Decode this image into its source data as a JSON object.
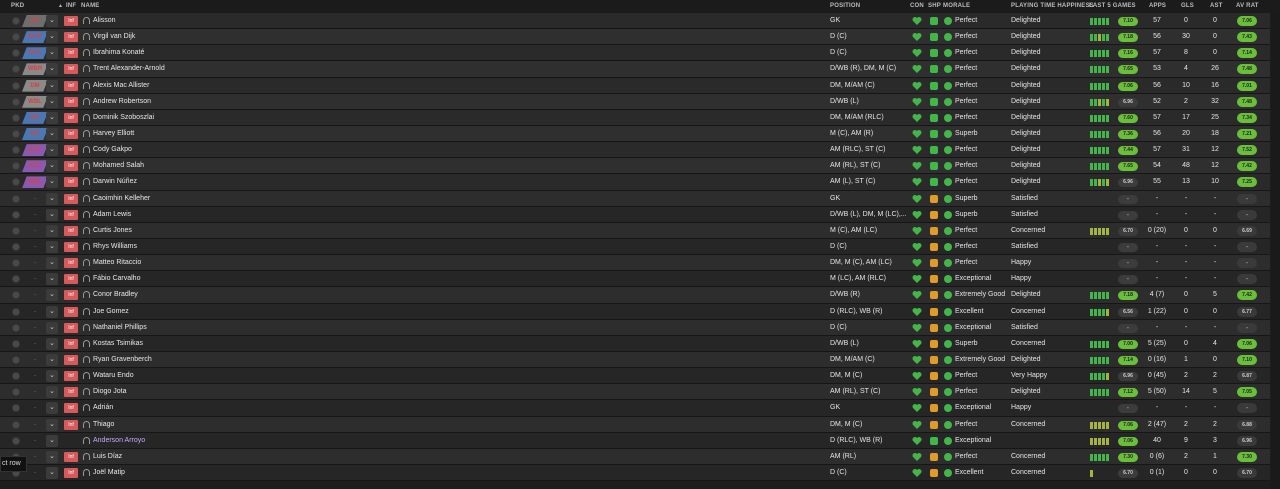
{
  "columns": {
    "pkd": "PKD",
    "inf": "INF",
    "name": "NAME",
    "position": "POSITION",
    "con": "CON",
    "shp": "SHP",
    "morale": "MORALE",
    "playing_time": "PLAYING TIME HAPPINESS",
    "last5": "LAST 5 GAMES",
    "apps": "APPS",
    "gls": "GLS",
    "ast": "AST",
    "avrat": "AV RAT"
  },
  "colors": {
    "badge_gk": "#6e6e6e",
    "badge_def": "#4a78b5",
    "badge_mid": "#8a8a8a",
    "badge_att": "#8b5ab0",
    "injury": "#d65a5a",
    "good": "#43b649",
    "warning": "#e09b2a",
    "rating": "#6abf3a"
  },
  "tooltip": "ct row",
  "players": [
    {
      "starter": true,
      "pos": "GK",
      "badge": "gk",
      "inj": "Inf",
      "name": "Alisson",
      "position": "GK",
      "shp": "green",
      "morale": "Perfect",
      "happy": "Delighted",
      "form": "ggggg",
      "last": "7.10",
      "apps": "57",
      "gls": "0",
      "ast": "0",
      "av": "7.06"
    },
    {
      "starter": true,
      "pos": "DCR",
      "badge": "def",
      "inj": "Inf",
      "name": "Virgil van Dijk",
      "position": "D (C)",
      "shp": "green",
      "morale": "Perfect",
      "happy": "Delighted",
      "form": "ggygg",
      "last": "7.18",
      "apps": "56",
      "gls": "30",
      "ast": "0",
      "av": "7.43"
    },
    {
      "starter": true,
      "pos": "DCL",
      "badge": "def",
      "inj": "Inf",
      "name": "Ibrahima Konaté",
      "position": "D (C)",
      "shp": "green",
      "morale": "Perfect",
      "happy": "Delighted",
      "form": "ggggg",
      "last": "7.16",
      "apps": "57",
      "gls": "8",
      "ast": "0",
      "av": "7.14"
    },
    {
      "starter": true,
      "pos": "WBR",
      "badge": "mid",
      "inj": "Inf",
      "name": "Trent Alexander-Arnold",
      "position": "D/WB (R), DM, M (C)",
      "shp": "green",
      "morale": "Perfect",
      "happy": "Delighted",
      "form": "ggggg",
      "last": "7.65",
      "apps": "53",
      "gls": "4",
      "ast": "26",
      "av": "7.48"
    },
    {
      "starter": true,
      "pos": "DM",
      "badge": "mid",
      "inj": "Inf",
      "name": "Alexis Mac Allister",
      "position": "DM, M/AM (C)",
      "shp": "green",
      "morale": "Perfect",
      "happy": "Delighted",
      "form": "ggggg",
      "last": "7.06",
      "apps": "56",
      "gls": "10",
      "ast": "16",
      "av": "7.01"
    },
    {
      "starter": true,
      "pos": "WBL",
      "badge": "mid",
      "inj": "Inf",
      "name": "Andrew Robertson",
      "position": "D/WB (L)",
      "shp": "green",
      "morale": "Perfect",
      "happy": "Delighted",
      "form": "ggygy",
      "last": "6.96",
      "apps": "52",
      "gls": "2",
      "ast": "32",
      "av": "7.48"
    },
    {
      "starter": true,
      "pos": "MC",
      "badge": "def",
      "inj": "Inf",
      "name": "Dominik Szoboszlai",
      "position": "DM, M/AM (RLC)",
      "shp": "green",
      "morale": "Perfect",
      "happy": "Delighted",
      "form": "ggggg",
      "last": "7.60",
      "apps": "57",
      "gls": "17",
      "ast": "25",
      "av": "7.34"
    },
    {
      "starter": true,
      "pos": "MC",
      "badge": "def",
      "inj": "Inf",
      "name": "Harvey Elliott",
      "position": "M (C), AM (R)",
      "shp": "green",
      "morale": "Superb",
      "happy": "Delighted",
      "form": "ggggg",
      "last": "7.36",
      "apps": "56",
      "gls": "20",
      "ast": "18",
      "av": "7.21"
    },
    {
      "starter": true,
      "pos": "STC",
      "badge": "att",
      "inj": "Inf",
      "name": "Cody Gakpo",
      "position": "AM (RLC), ST (C)",
      "shp": "green",
      "morale": "Perfect",
      "happy": "Delighted",
      "form": "ggggg",
      "last": "7.44",
      "apps": "57",
      "gls": "31",
      "ast": "12",
      "av": "7.52"
    },
    {
      "starter": true,
      "pos": "STC",
      "badge": "att",
      "inj": "Inf",
      "name": "Mohamed Salah",
      "position": "AM (RL), ST (C)",
      "shp": "green",
      "morale": "Perfect",
      "happy": "Delighted",
      "form": "ggggg",
      "last": "7.65",
      "apps": "54",
      "gls": "48",
      "ast": "12",
      "av": "7.42"
    },
    {
      "starter": true,
      "pos": "MDL",
      "badge": "att",
      "inj": "Inf",
      "name": "Darwin Núñez",
      "position": "AM (L), ST (C)",
      "shp": "green",
      "morale": "Perfect",
      "happy": "Delighted",
      "form": "ggygy",
      "last": "6.96",
      "apps": "55",
      "gls": "13",
      "ast": "10",
      "av": "7.25"
    },
    {
      "starter": false,
      "pos": "-",
      "badge": "",
      "inj": "Inf",
      "name": "Caoimhin Kelleher",
      "position": "GK",
      "shp": "orange",
      "morale": "Superb",
      "happy": "Satisfied",
      "form": "",
      "last": "-",
      "apps": "-",
      "gls": "-",
      "ast": "-",
      "av": "-"
    },
    {
      "starter": false,
      "pos": "-",
      "badge": "",
      "inj": "Inf",
      "name": "Adam Lewis",
      "position": "D/WB (L), DM, M (LC),...",
      "shp": "orange",
      "morale": "Superb",
      "happy": "Satisfied",
      "form": "",
      "last": "-",
      "apps": "-",
      "gls": "-",
      "ast": "-",
      "av": "-"
    },
    {
      "starter": false,
      "pos": "-",
      "badge": "",
      "inj": "Inf",
      "name": "Curtis Jones",
      "position": "M (C), AM (LC)",
      "shp": "orange",
      "morale": "Perfect",
      "happy": "Concerned",
      "form": "yyyyy",
      "last": "6.70",
      "apps": "0 (20)",
      "gls": "0",
      "ast": "0",
      "av": "6.69"
    },
    {
      "starter": false,
      "pos": "-",
      "badge": "",
      "inj": "Inf",
      "name": "Rhys Williams",
      "position": "D (C)",
      "shp": "orange",
      "morale": "Perfect",
      "happy": "Satisfied",
      "form": "",
      "last": "-",
      "apps": "-",
      "gls": "-",
      "ast": "-",
      "av": "-"
    },
    {
      "starter": false,
      "pos": "-",
      "badge": "",
      "inj": "Inf",
      "name": "Matteo Ritaccio",
      "position": "DM, M (C), AM (LC)",
      "shp": "orange",
      "morale": "Perfect",
      "happy": "Happy",
      "form": "",
      "last": "-",
      "apps": "-",
      "gls": "-",
      "ast": "-",
      "av": "-"
    },
    {
      "starter": false,
      "pos": "-",
      "badge": "",
      "inj": "Inf",
      "name": "Fábio Carvalho",
      "position": "M (LC), AM (RLC)",
      "shp": "orange",
      "morale": "Exceptional",
      "happy": "Happy",
      "form": "",
      "last": "-",
      "apps": "-",
      "gls": "-",
      "ast": "-",
      "av": "-"
    },
    {
      "starter": false,
      "pos": "-",
      "badge": "",
      "inj": "Inf",
      "name": "Conor Bradley",
      "position": "D/WB (R)",
      "shp": "orange",
      "morale": "Extremely Good",
      "happy": "Delighted",
      "form": "ggggg",
      "last": "7.18",
      "apps": "4 (7)",
      "gls": "0",
      "ast": "5",
      "av": "7.42"
    },
    {
      "starter": false,
      "pos": "-",
      "badge": "",
      "inj": "Inf",
      "name": "Joe Gomez",
      "position": "D (RLC), WB (R)",
      "shp": "orange",
      "morale": "Excellent",
      "happy": "Concerned",
      "form": "ggggy",
      "last": "6.56",
      "apps": "1 (22)",
      "gls": "0",
      "ast": "0",
      "av": "6.77"
    },
    {
      "starter": false,
      "pos": "-",
      "badge": "",
      "inj": "Inf",
      "name": "Nathaniel Phillips",
      "position": "D (C)",
      "shp": "orange",
      "morale": "Exceptional",
      "happy": "Satisfied",
      "form": "",
      "last": "-",
      "apps": "-",
      "gls": "-",
      "ast": "-",
      "av": "-"
    },
    {
      "starter": false,
      "pos": "-",
      "badge": "",
      "inj": "Inf",
      "name": "Kostas Tsimikas",
      "position": "D/WB (L)",
      "shp": "orange",
      "morale": "Superb",
      "happy": "Concerned",
      "form": "ggggg",
      "last": "7.00",
      "apps": "5 (25)",
      "gls": "0",
      "ast": "4",
      "av": "7.06"
    },
    {
      "starter": false,
      "pos": "-",
      "badge": "",
      "inj": "Inf",
      "name": "Ryan Gravenberch",
      "position": "DM, M/AM (C)",
      "shp": "orange",
      "morale": "Extremely Good",
      "happy": "Delighted",
      "form": "ggggg",
      "last": "7.14",
      "apps": "0 (16)",
      "gls": "1",
      "ast": "0",
      "av": "7.10"
    },
    {
      "starter": false,
      "pos": "-",
      "badge": "",
      "inj": "Inf",
      "name": "Wataru Endo",
      "position": "DM, M (C)",
      "shp": "orange",
      "morale": "Perfect",
      "happy": "Very Happy",
      "form": "ggggy",
      "last": "6.96",
      "apps": "0 (45)",
      "gls": "2",
      "ast": "2",
      "av": "6.87"
    },
    {
      "starter": false,
      "pos": "-",
      "badge": "",
      "inj": "Inf",
      "name": "Diogo Jota",
      "position": "AM (RL), ST (C)",
      "shp": "orange",
      "morale": "Perfect",
      "happy": "Delighted",
      "form": "ggggg",
      "last": "7.12",
      "apps": "5 (50)",
      "gls": "14",
      "ast": "5",
      "av": "7.05"
    },
    {
      "starter": false,
      "pos": "-",
      "badge": "",
      "inj": "Inf",
      "name": "Adrián",
      "position": "GK",
      "shp": "orange",
      "morale": "Exceptional",
      "happy": "Happy",
      "form": "",
      "last": "-",
      "apps": "-",
      "gls": "-",
      "ast": "-",
      "av": "-"
    },
    {
      "starter": false,
      "pos": "-",
      "badge": "",
      "inj": "Inf",
      "name": "Thiago",
      "position": "DM, M (C)",
      "shp": "orange",
      "morale": "Perfect",
      "happy": "Concerned",
      "form": "yyyyy",
      "last": "7.06",
      "apps": "2 (47)",
      "gls": "2",
      "ast": "2",
      "av": "6.88"
    },
    {
      "starter": false,
      "pos": "-",
      "badge": "",
      "inj": "",
      "name": "Anderson Arroyo",
      "position": "D (RLC), WB (R)",
      "shp": "green",
      "morale": "Exceptional",
      "happy": "",
      "form": "yyyyy",
      "last": "7.06",
      "apps": "40",
      "gls": "9",
      "ast": "3",
      "av": "6.96",
      "purple": true
    },
    {
      "starter": false,
      "pos": "-",
      "badge": "",
      "inj": "Inf",
      "name": "Luis Díaz",
      "position": "AM (RL)",
      "shp": "orange",
      "morale": "Perfect",
      "happy": "Concerned",
      "form": "ggggg",
      "last": "7.30",
      "apps": "0 (6)",
      "gls": "2",
      "ast": "1",
      "av": "7.30"
    },
    {
      "starter": false,
      "pos": "-",
      "badge": "",
      "inj": "Inf",
      "name": "Joël Matip",
      "position": "D (C)",
      "shp": "orange",
      "morale": "Excellent",
      "happy": "Concerned",
      "form": "y",
      "last": "6.70",
      "apps": "0 (1)",
      "gls": "0",
      "ast": "0",
      "av": "6.70"
    }
  ]
}
